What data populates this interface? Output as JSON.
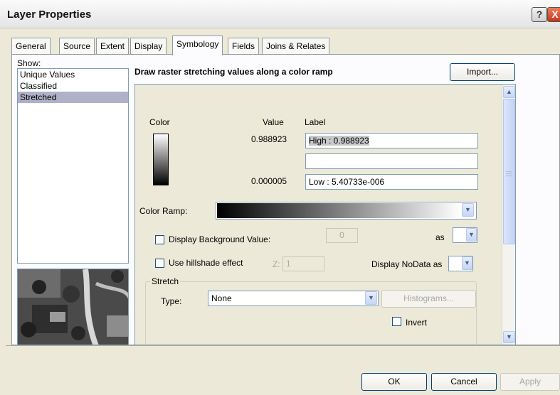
{
  "window": {
    "title": "Layer Properties",
    "help_label": "?",
    "close_label": "X"
  },
  "tabs": [
    {
      "label": "General"
    },
    {
      "label": "Source"
    },
    {
      "label": "Extent"
    },
    {
      "label": "Display"
    },
    {
      "label": "Symbology"
    },
    {
      "label": "Fields"
    },
    {
      "label": "Joins & Relates"
    }
  ],
  "active_tab": "Symbology",
  "show": {
    "label": "Show:",
    "items": [
      {
        "label": "Unique Values"
      },
      {
        "label": "Classified"
      },
      {
        "label": "Stretched"
      }
    ],
    "selected": "Stretched"
  },
  "symbology": {
    "header": "Draw raster stretching values along a color ramp",
    "import_label": "Import...",
    "color_col": "Color",
    "value_col": "Value",
    "label_col": "Label",
    "high_value": "0.988923",
    "high_label": "High : 0.988923",
    "mid_label": "",
    "low_value": "0.000005",
    "low_label": "Low : 5.40733e-006",
    "color_ramp_label": "Color Ramp:",
    "display_bg_label": "Display Background Value:",
    "bg_value": "0",
    "as_label": "as",
    "hillshade_label": "Use hillshade effect",
    "z_label": "Z:",
    "z_value": "1",
    "nodata_label": "Display NoData as",
    "stretch_legend": "Stretch",
    "type_label": "Type:",
    "type_value": "None",
    "histograms_label": "Histograms...",
    "invert_label": "Invert"
  },
  "footer": {
    "ok": "OK",
    "cancel": "Cancel",
    "apply": "Apply"
  },
  "colors": {
    "selection": "#b0b0c8",
    "ramp_start": "#000000",
    "ramp_end": "#ffffff"
  }
}
